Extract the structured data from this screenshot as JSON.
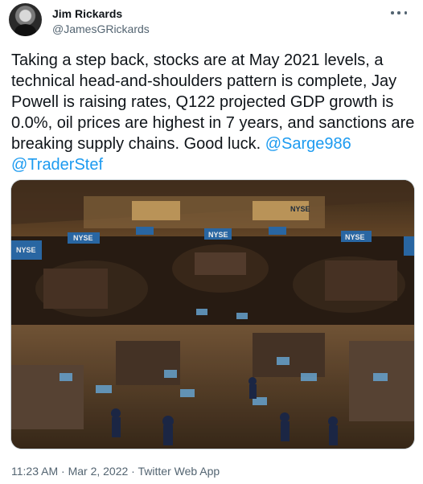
{
  "author": {
    "name": "Jim Rickards",
    "handle": "@JamesGRickards"
  },
  "tweet": {
    "text_plain": "Taking a step back, stocks are at May 2021 levels, a technical head-and-shoulders pattern is complete, Jay Powell is raising rates, Q122 projected GDP growth is 0.0%, oil prices are highest in 7 years, and sanctions are breaking supply chains. Good luck.",
    "mentions": [
      "@Sarge986",
      "@TraderStef"
    ]
  },
  "image": {
    "signs": [
      "NYSE",
      "NYSE",
      "NYSE",
      "NYSE",
      "NYSE",
      "NYSE",
      "NYSE"
    ]
  },
  "meta": {
    "time": "11:23 AM",
    "date": "Mar 2, 2022",
    "app": "Twitter Web App",
    "separator": " · "
  },
  "icons": [
    "more-horizontal-icon"
  ],
  "colors": {
    "link": "#1d9bf0",
    "secondary": "#536471",
    "text": "#0f1419"
  }
}
